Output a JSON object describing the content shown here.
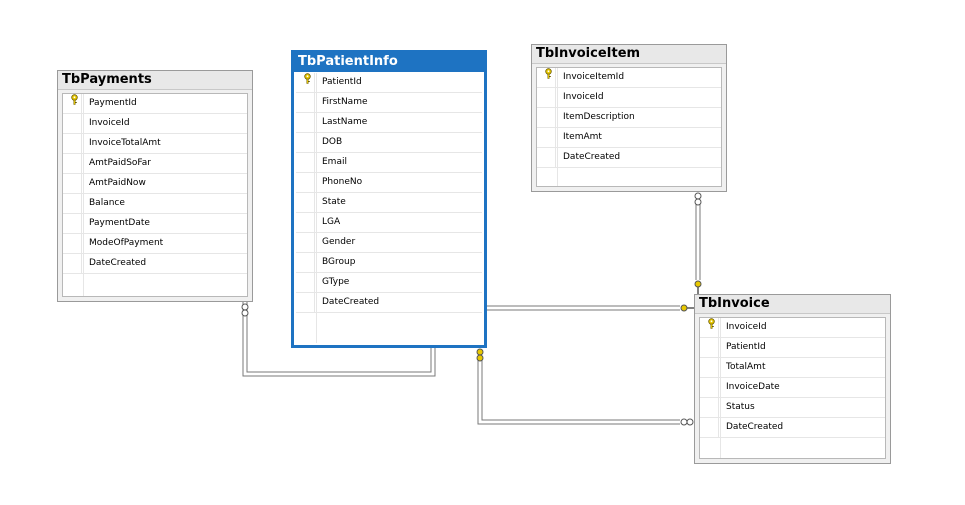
{
  "tables": {
    "payments": {
      "title": "TbPayments",
      "columns": [
        "PaymentId",
        "InvoiceId",
        "InvoiceTotalAmt",
        "AmtPaidSoFar",
        "AmtPaidNow",
        "Balance",
        "PaymentDate",
        "ModeOfPayment",
        "DateCreated"
      ],
      "key_column": "PaymentId"
    },
    "patientinfo": {
      "title": "TbPatientInfo",
      "columns": [
        "PatientId",
        "FirstName",
        "LastName",
        "DOB",
        "Email",
        "PhoneNo",
        "State",
        "LGA",
        "Gender",
        "BGroup",
        "GType",
        "DateCreated"
      ],
      "key_column": "PatientId",
      "selected": true
    },
    "invoiceitem": {
      "title": "TbInvoiceItem",
      "columns": [
        "InvoiceItemId",
        "InvoiceId",
        "ItemDescription",
        "ItemAmt",
        "DateCreated"
      ],
      "key_column": "InvoiceItemId"
    },
    "invoice": {
      "title": "TbInvoice",
      "columns": [
        "InvoiceId",
        "PatientId",
        "TotalAmt",
        "InvoiceDate",
        "Status",
        "DateCreated"
      ],
      "key_column": "InvoiceId"
    }
  },
  "colors": {
    "selected_header": "#1e73c2",
    "key_icon": "#e8c800",
    "relation_line": "#7a7a7a"
  },
  "icons": {
    "primary_key": "key-icon",
    "relation_one_end": "key-icon",
    "relation_many_end": "infinity-icon"
  }
}
